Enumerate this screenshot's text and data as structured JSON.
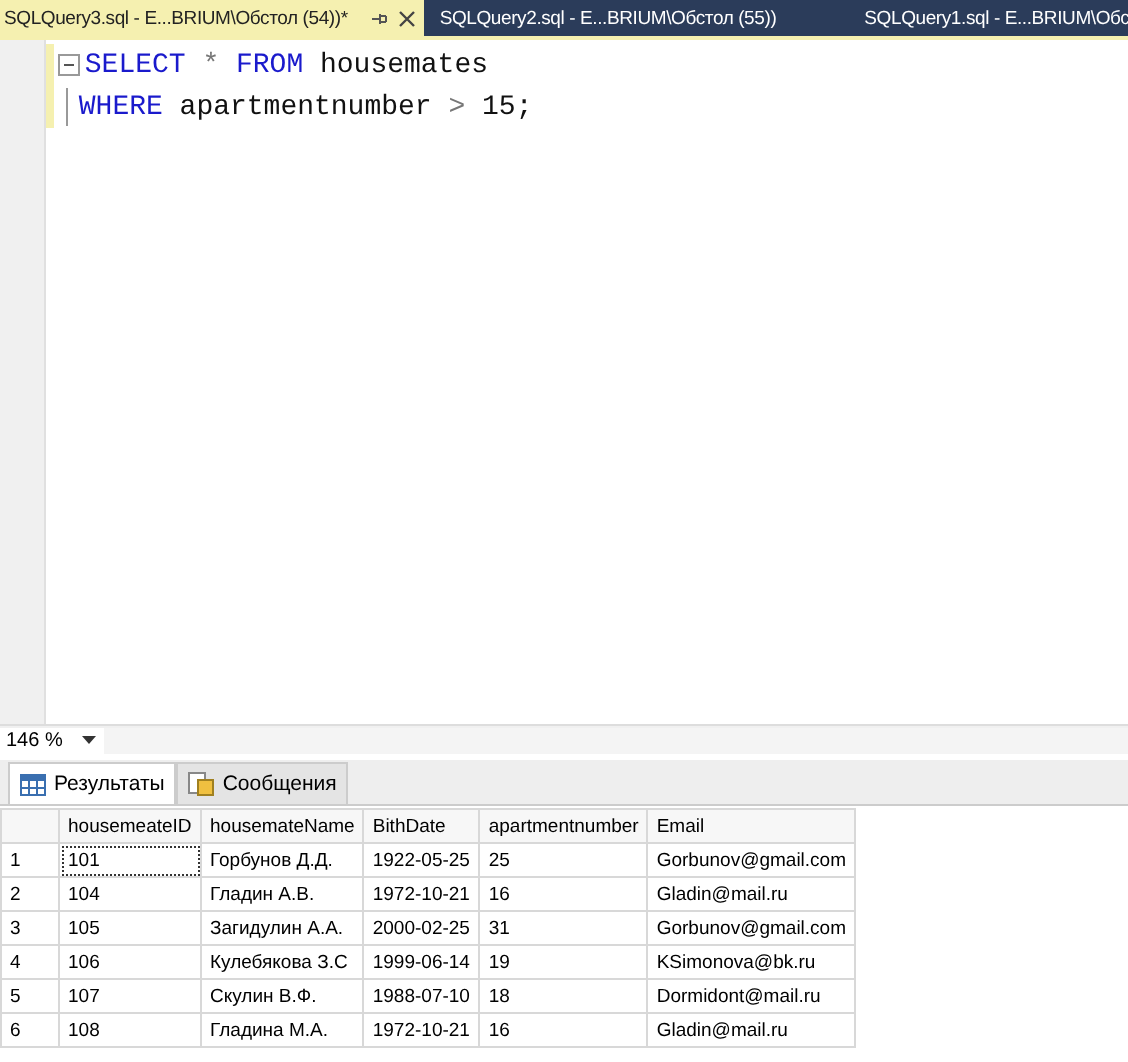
{
  "doc_tabs": [
    {
      "label": "SQLQuery3.sql - E...BRIUM\\Обстол (54))*",
      "selected": true
    },
    {
      "label": "SQLQuery2.sql - E...BRIUM\\Обстол (55))",
      "selected": false
    },
    {
      "label": "SQLQuery1.sql - E...BRIUM\\Обс",
      "selected": false
    }
  ],
  "editor": {
    "lines": [
      [
        {
          "kind": "keyword",
          "text": "SELECT"
        },
        {
          "kind": "operator",
          "text": "*"
        },
        {
          "kind": "keyword",
          "text": "FROM"
        },
        {
          "kind": "plain",
          "text": "housemates"
        }
      ],
      [
        {
          "kind": "keyword",
          "text": "WHERE"
        },
        {
          "kind": "plain",
          "text": "apartmentnumber"
        },
        {
          "kind": "operator",
          "text": ">"
        },
        {
          "kind": "plain",
          "text": "15;"
        }
      ]
    ]
  },
  "zoom": {
    "value": "146 %"
  },
  "result_tabs": [
    {
      "label": "Результаты",
      "selected": true
    },
    {
      "label": "Сообщения",
      "selected": false
    }
  ],
  "table": {
    "columns": [
      "housemeateID",
      "housemateName",
      "BithDate",
      "apartmentnumber",
      "Email"
    ],
    "rows": [
      {
        "num": "1",
        "cells": [
          "101",
          "Горбунов Д.Д.",
          "1922-05-25",
          "25",
          "Gorbunov@gmail.com"
        ],
        "selected": true
      },
      {
        "num": "2",
        "cells": [
          "104",
          "Гладин А.В.",
          "1972-10-21",
          "16",
          "Gladin@mail.ru"
        ],
        "selected": false
      },
      {
        "num": "3",
        "cells": [
          "105",
          "Загидулин А.А.",
          "2000-02-25",
          "31",
          "Gorbunov@gmail.com"
        ],
        "selected": false
      },
      {
        "num": "4",
        "cells": [
          "106",
          "Кулебякова З.С",
          "1999-06-14",
          "19",
          "KSimonova@bk.ru"
        ],
        "selected": false
      },
      {
        "num": "5",
        "cells": [
          "107",
          "Скулин В.Ф.",
          "1988-07-10",
          "18",
          "Dormidont@mail.ru"
        ],
        "selected": false
      },
      {
        "num": "6",
        "cells": [
          "108",
          "Гладина М.А.",
          "1972-10-21",
          "16",
          "Gladin@mail.ru"
        ],
        "selected": false
      }
    ]
  }
}
